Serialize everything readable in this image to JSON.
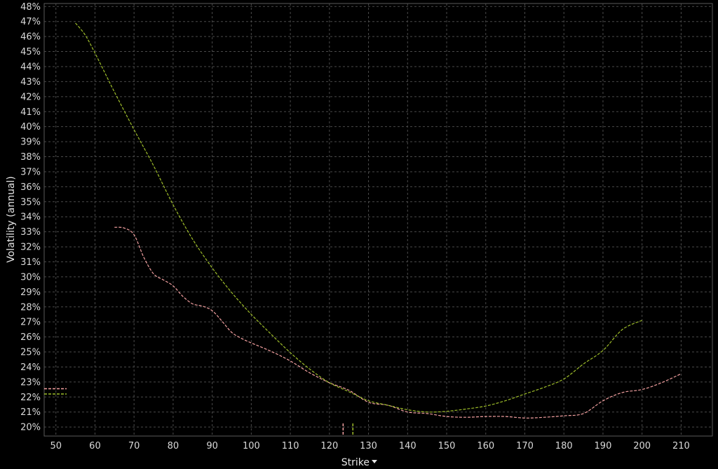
{
  "chart_data": {
    "type": "line",
    "xlabel": "Strike",
    "ylabel": "Volatility (annual)",
    "xlim": [
      47,
      218
    ],
    "ylim": [
      19.4,
      48.2
    ],
    "x_ticks": [
      50,
      60,
      70,
      80,
      90,
      100,
      110,
      120,
      130,
      140,
      150,
      160,
      170,
      180,
      190,
      200,
      210
    ],
    "y_ticks": [
      20,
      21,
      22,
      23,
      24,
      25,
      26,
      27,
      28,
      29,
      30,
      31,
      32,
      33,
      34,
      35,
      36,
      37,
      38,
      39,
      40,
      41,
      42,
      43,
      44,
      45,
      46,
      47,
      48
    ],
    "y_tick_suffix": "%",
    "grid": true,
    "series": [
      {
        "color": "#f4a1a1",
        "x": [
          65,
          67.5,
          70,
          72.5,
          75,
          77.5,
          80,
          82.5,
          85,
          87.5,
          90,
          92.5,
          95,
          97.5,
          100,
          105,
          110,
          115,
          120,
          125,
          130,
          135,
          140,
          145,
          150,
          155,
          160,
          165,
          170,
          175,
          180,
          185,
          190,
          195,
          200,
          205,
          210
        ],
        "values": [
          33.3,
          33.25,
          32.8,
          31.3,
          30.2,
          29.8,
          29.4,
          28.7,
          28.2,
          28.05,
          27.75,
          27.05,
          26.3,
          25.9,
          25.6,
          25.05,
          24.4,
          23.6,
          22.95,
          22.45,
          21.65,
          21.45,
          21.0,
          20.9,
          20.7,
          20.65,
          20.7,
          20.7,
          20.6,
          20.65,
          20.75,
          20.9,
          21.75,
          22.3,
          22.5,
          22.95,
          23.55
        ]
      },
      {
        "color": "#9ebd2a",
        "x": [
          55,
          57.5,
          60,
          62.5,
          65,
          70,
          75,
          80,
          85,
          90,
          95,
          100,
          105,
          110,
          115,
          120,
          125,
          130,
          135,
          140,
          145,
          150,
          155,
          160,
          165,
          170,
          175,
          180,
          185,
          190,
          195,
          200
        ],
        "values": [
          46.9,
          46.1,
          44.9,
          43.6,
          42.3,
          39.8,
          37.4,
          34.8,
          32.5,
          30.6,
          28.95,
          27.5,
          26.2,
          24.95,
          23.85,
          22.95,
          22.35,
          21.75,
          21.45,
          21.15,
          21.0,
          21.05,
          21.2,
          21.4,
          21.75,
          22.2,
          22.65,
          23.2,
          24.2,
          25.1,
          26.5,
          27.1
        ]
      }
    ],
    "left_markers": [
      {
        "color": "#f4a1a1",
        "value": 22.55
      },
      {
        "color": "#9ebd2a",
        "value": 22.2
      }
    ],
    "bottom_markers": [
      {
        "color": "#f4a1a1",
        "value": 123.5
      },
      {
        "color": "#9ebd2a",
        "value": 126
      }
    ]
  }
}
